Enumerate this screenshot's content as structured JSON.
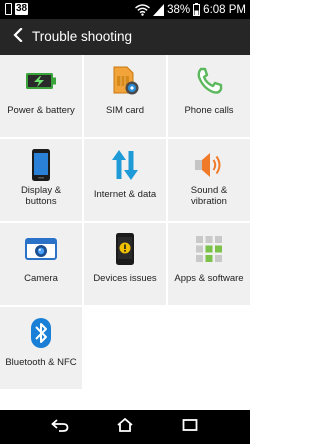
{
  "status_bar": {
    "notification_badge": "38",
    "battery_percent": "38%",
    "time": "6:08 PM",
    "icons": [
      "notification-icon",
      "wifi-icon",
      "signal-icon",
      "battery-icon"
    ]
  },
  "app_bar": {
    "title": "Trouble shooting",
    "back_icon": "back-arrow-icon"
  },
  "tiles": [
    {
      "label": "Power & battery",
      "icon": "battery-icon"
    },
    {
      "label": "SIM card",
      "icon": "sim-card-icon"
    },
    {
      "label": "Phone calls",
      "icon": "phone-icon"
    },
    {
      "label_lines": [
        "Display &",
        "buttons"
      ],
      "icon": "display-icon"
    },
    {
      "label": "Internet & data",
      "icon": "data-transfer-icon"
    },
    {
      "label_lines": [
        "Sound &",
        "vibration"
      ],
      "icon": "speaker-icon"
    },
    {
      "label": "Camera",
      "icon": "camera-icon"
    },
    {
      "label": "Devices issues",
      "icon": "device-warning-icon"
    },
    {
      "label": "Apps & software",
      "icon": "apps-grid-icon"
    },
    {
      "label": "Bluetooth & NFC",
      "icon": "bluetooth-icon"
    }
  ],
  "nav_bar": {
    "icons": [
      "nav-back-icon",
      "home-icon",
      "recent-apps-icon"
    ]
  },
  "colors": {
    "app_bar": "#262626",
    "tile_background": "#f0f0f0",
    "battery_green": "#3aa43a",
    "sim_orange": "#f2a33a",
    "phone_green": "#5cb85c",
    "data_blue": "#1e9bd7",
    "speaker_orange": "#f07a28",
    "camera_blue": "#2a72c8",
    "warning_yellow": "#f0c000",
    "bluetooth_blue": "#1a7fd6"
  }
}
